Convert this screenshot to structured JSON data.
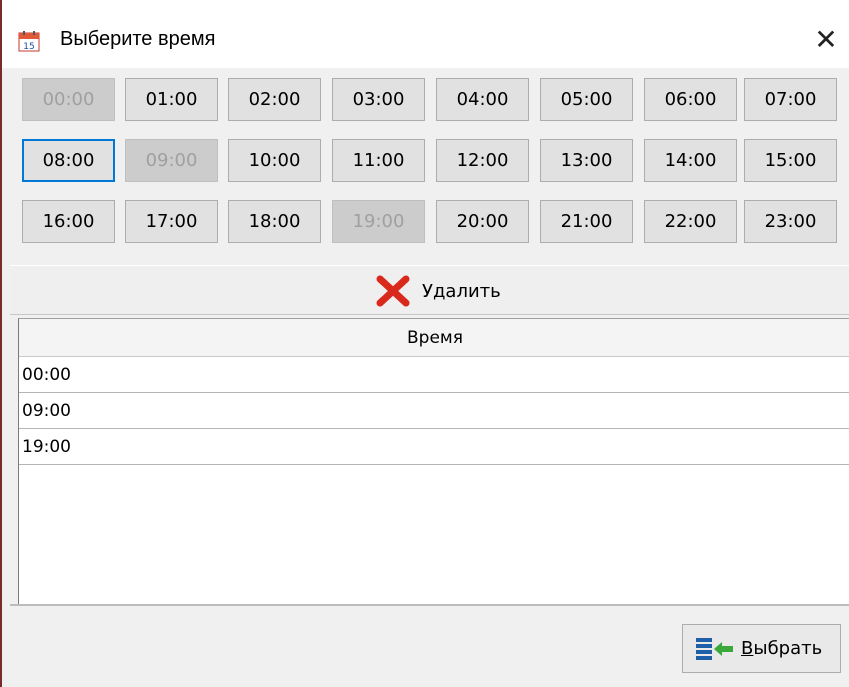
{
  "window": {
    "title": "Выберите время",
    "title_icon": "calendar-icon",
    "title_icon_text": "15",
    "close_glyph": "✕"
  },
  "hours": [
    {
      "label": "00:00",
      "state": "disabled"
    },
    {
      "label": "01:00",
      "state": "normal"
    },
    {
      "label": "02:00",
      "state": "normal"
    },
    {
      "label": "03:00",
      "state": "normal"
    },
    {
      "label": "04:00",
      "state": "normal"
    },
    {
      "label": "05:00",
      "state": "normal"
    },
    {
      "label": "06:00",
      "state": "normal"
    },
    {
      "label": "07:00",
      "state": "normal"
    },
    {
      "label": "08:00",
      "state": "focused"
    },
    {
      "label": "09:00",
      "state": "disabled"
    },
    {
      "label": "10:00",
      "state": "normal"
    },
    {
      "label": "11:00",
      "state": "normal"
    },
    {
      "label": "12:00",
      "state": "normal"
    },
    {
      "label": "13:00",
      "state": "normal"
    },
    {
      "label": "14:00",
      "state": "normal"
    },
    {
      "label": "15:00",
      "state": "normal"
    },
    {
      "label": "16:00",
      "state": "normal"
    },
    {
      "label": "17:00",
      "state": "normal"
    },
    {
      "label": "18:00",
      "state": "normal"
    },
    {
      "label": "19:00",
      "state": "disabled"
    },
    {
      "label": "20:00",
      "state": "normal"
    },
    {
      "label": "21:00",
      "state": "normal"
    },
    {
      "label": "22:00",
      "state": "normal"
    },
    {
      "label": "23:00",
      "state": "normal"
    }
  ],
  "delete_button": {
    "label": "Удалить",
    "icon": "red-x-icon"
  },
  "grid": {
    "column_header": "Время",
    "rows": [
      "00:00",
      "09:00",
      "19:00"
    ]
  },
  "select_button": {
    "label_mnemonic": "В",
    "label_rest": "ыбрать",
    "icon": "select-arrow-icon"
  },
  "colors": {
    "focus_border": "#0078d7",
    "delete_icon": "#d9281c",
    "select_icon_blue": "#1f5fa8",
    "select_icon_green": "#3aa83a"
  }
}
